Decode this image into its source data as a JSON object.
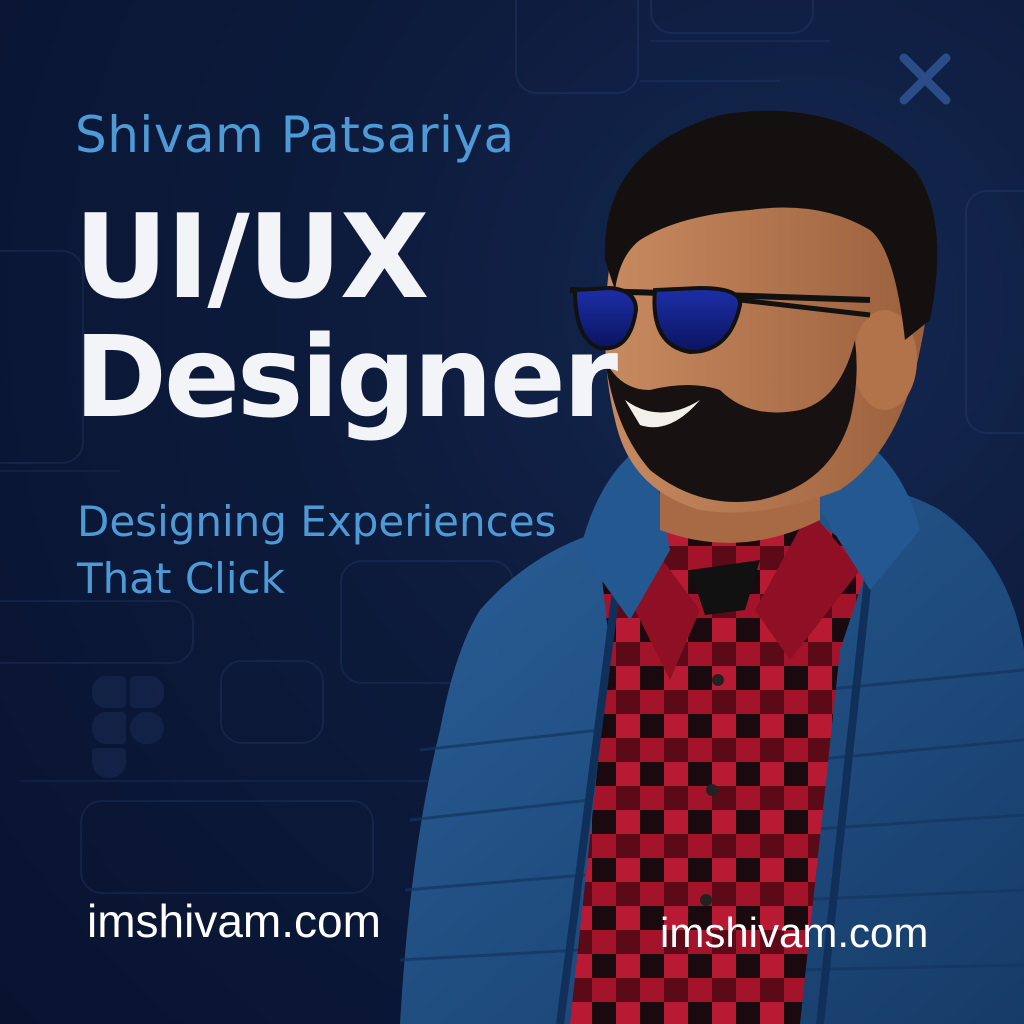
{
  "profile": {
    "name": "Shivam Patsariya",
    "title_line_1": "UI/UX",
    "title_line_2": "Designer",
    "tagline_line_1": "Designing Experiences",
    "tagline_line_2": "That Click",
    "website_left": "imshivam.com",
    "website_right": "imshivam.com"
  },
  "icons": {
    "close": "close-icon"
  },
  "colors": {
    "background": "#0d1b3c",
    "accent_blue": "#4e9ad6",
    "title_white": "#f2f4f8",
    "jacket_blue": "#1f4f86",
    "shirt_red": "#a3132a"
  }
}
